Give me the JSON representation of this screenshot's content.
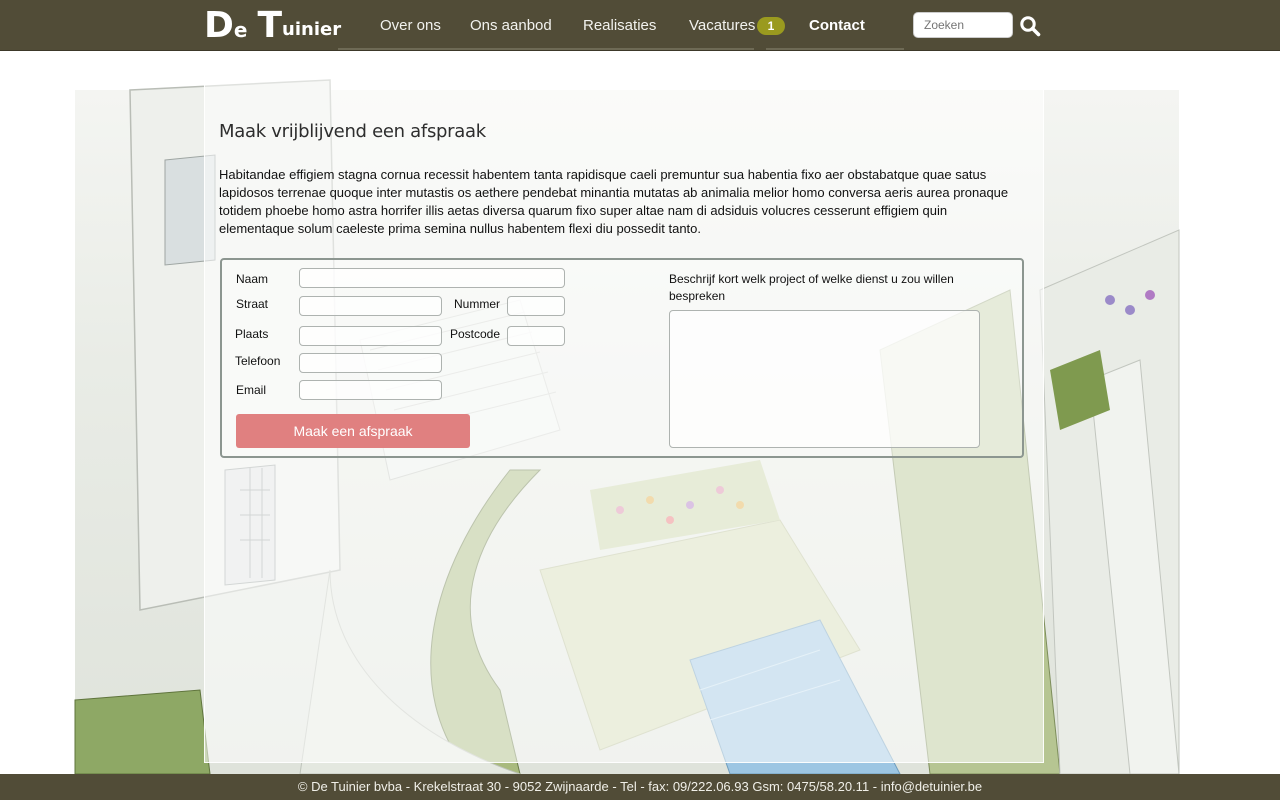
{
  "brand": {
    "logo_big_1": "D",
    "logo_small_1": "e",
    "logo_big_2": "T",
    "logo_small_2": "uinier"
  },
  "nav": {
    "items": [
      "Over ons",
      "Ons aanbod",
      "Realisaties",
      "Vacatures",
      "Contact"
    ],
    "active": "Contact",
    "vacatures_badge": "1"
  },
  "search": {
    "placeholder": "Zoeken",
    "icon": "search-icon"
  },
  "main": {
    "title": "Maak vrijblijvend een afspraak",
    "intro": "Habitandae effigiem stagna cornua recessit habentem tanta rapidisque caeli premuntur sua habentia fixo aer obstabatque quae satus lapidosos terrenae quoque inter mutastis os aethere pendebat minantia mutatas ab animalia melior homo conversa aeris aurea pronaque totidem phoebe homo astra horrifer illis aetas diversa quarum fixo super altae nam di adsiduis volucres cesserunt effigiem quin elementaque solum caeleste prima semina nullus habentem flexi diu possedit tanto."
  },
  "form": {
    "naam_label": "Naam",
    "straat_label": "Straat",
    "nummer_label": "Nummer",
    "plaats_label": "Plaats",
    "postcode_label": "Postcode",
    "telefoon_label": "Telefoon",
    "email_label": "Email",
    "submit_label": "Maak een afspraak",
    "description_label": "Beschrijf kort welk project of welke dienst u zou willen bespreken"
  },
  "footer": {
    "text": "© De Tuinier bvba - Krekelstraat 30 - 9052 Zwijnaarde - Tel - fax:  09/222.06.93 Gsm: 0475/58.20.11 - info@detuinier.be"
  },
  "colors": {
    "header": "#514c37",
    "accent_button": "#e08080",
    "badge": "#9a9a1f"
  }
}
